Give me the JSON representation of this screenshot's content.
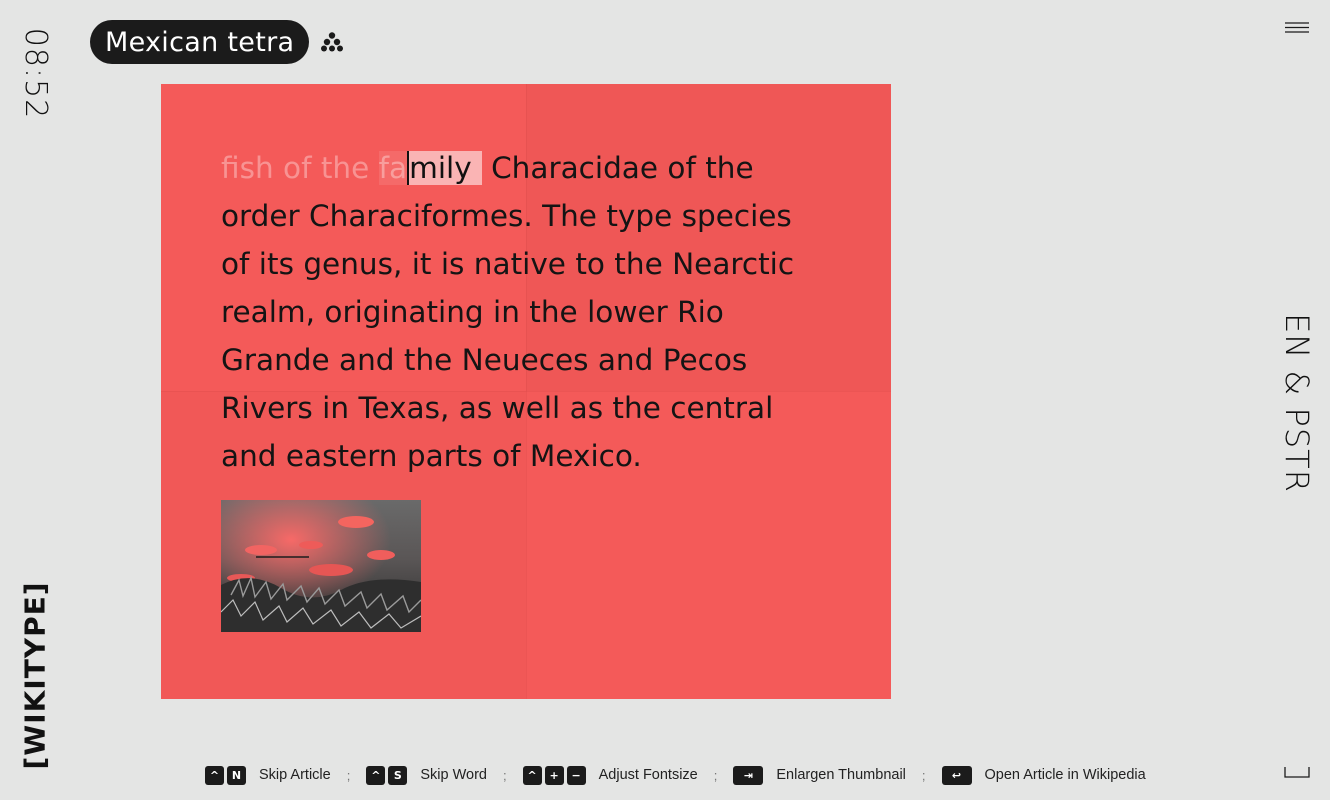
{
  "clock": "08:52",
  "logo": "[WIKITYPE]",
  "language": "EN & PSTR",
  "article": {
    "title": "Mexican tetra",
    "lines": [
      {
        "typed": "fish of the ",
        "typed_hl": "fa",
        "current": "mily",
        "rest": " Characidae of the"
      },
      {
        "text": "order Characiformes. The type species"
      },
      {
        "text": "of its genus, it is native to the Nearctic"
      },
      {
        "text": "realm, originating in the lower Rio"
      },
      {
        "text": "Grande and the Neueces and Pecos"
      },
      {
        "text": "Rivers in Texas, as well as the central"
      },
      {
        "text": "and eastern parts of Mexico."
      }
    ]
  },
  "icons": {
    "random": "random-icon",
    "menu": "menu-icon",
    "fullscreen": "fullscreen-icon"
  },
  "shortcuts": [
    {
      "keys": [
        "^",
        "N"
      ],
      "label": "Skip Article"
    },
    {
      "keys": [
        "^",
        "S"
      ],
      "label": "Skip Word"
    },
    {
      "keys": [
        "^",
        "+",
        "−"
      ],
      "label": "Adjust Fontsize"
    },
    {
      "keys": [
        "⇥"
      ],
      "label": "Enlargen Thumbnail"
    },
    {
      "keys": [
        "↩"
      ],
      "label": "Open Article in Wikipedia"
    }
  ],
  "separator": ";",
  "colors": {
    "background": "#e4e5e4",
    "card": "#f45a59",
    "pill": "#1b1b1b"
  }
}
